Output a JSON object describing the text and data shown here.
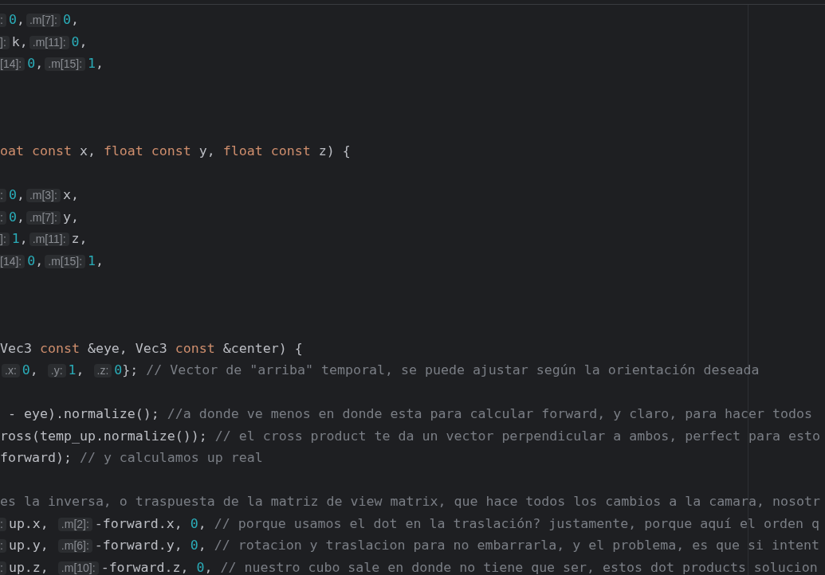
{
  "editor": {
    "lines": [
      {
        "kind": "code",
        "segments": [
          {
            "kind": "cuthint",
            "text": ":"
          },
          {
            "kind": "code",
            "tokens": [
              {
                "kind": "number",
                "text": "0"
              },
              {
                "kind": "plain",
                "text": ","
              }
            ]
          },
          {
            "kind": "hint",
            "text": ".m[7]:"
          },
          {
            "kind": "code",
            "tokens": [
              {
                "kind": "number",
                "text": "0"
              },
              {
                "kind": "plain",
                "text": ","
              }
            ]
          }
        ]
      },
      {
        "kind": "code",
        "segments": [
          {
            "kind": "cuthint",
            "text": "]:"
          },
          {
            "kind": "code",
            "tokens": [
              {
                "kind": "plain",
                "text": "k,"
              }
            ]
          },
          {
            "kind": "hint",
            "text": ".m[11]:"
          },
          {
            "kind": "code",
            "tokens": [
              {
                "kind": "number",
                "text": "0"
              },
              {
                "kind": "plain",
                "text": ","
              }
            ]
          }
        ]
      },
      {
        "kind": "code",
        "segments": [
          {
            "kind": "cuthint",
            "text": "[14]:"
          },
          {
            "kind": "code",
            "tokens": [
              {
                "kind": "number",
                "text": "0"
              },
              {
                "kind": "plain",
                "text": ","
              }
            ]
          },
          {
            "kind": "hint",
            "text": ".m[15]:"
          },
          {
            "kind": "code",
            "tokens": [
              {
                "kind": "number",
                "text": "1"
              },
              {
                "kind": "plain",
                "text": ","
              }
            ]
          }
        ]
      },
      {
        "kind": "blank"
      },
      {
        "kind": "blank"
      },
      {
        "kind": "blank"
      },
      {
        "kind": "code",
        "segments": [
          {
            "kind": "code",
            "tokens": [
              {
                "kind": "keyword",
                "text": "oat const"
              },
              {
                "kind": "plain",
                "text": " x, "
              },
              {
                "kind": "keyword",
                "text": "float const"
              },
              {
                "kind": "plain",
                "text": " y, "
              },
              {
                "kind": "keyword",
                "text": "float const"
              },
              {
                "kind": "plain",
                "text": " z) {"
              }
            ]
          }
        ]
      },
      {
        "kind": "blank"
      },
      {
        "kind": "code",
        "segments": [
          {
            "kind": "cuthint",
            "text": ":"
          },
          {
            "kind": "code",
            "tokens": [
              {
                "kind": "number",
                "text": "0"
              },
              {
                "kind": "plain",
                "text": ","
              }
            ]
          },
          {
            "kind": "hint",
            "text": ".m[3]:"
          },
          {
            "kind": "code",
            "tokens": [
              {
                "kind": "plain",
                "text": "x,"
              }
            ]
          }
        ]
      },
      {
        "kind": "code",
        "segments": [
          {
            "kind": "cuthint",
            "text": ":"
          },
          {
            "kind": "code",
            "tokens": [
              {
                "kind": "number",
                "text": "0"
              },
              {
                "kind": "plain",
                "text": ","
              }
            ]
          },
          {
            "kind": "hint",
            "text": ".m[7]:"
          },
          {
            "kind": "code",
            "tokens": [
              {
                "kind": "plain",
                "text": "y,"
              }
            ]
          }
        ]
      },
      {
        "kind": "code",
        "segments": [
          {
            "kind": "cuthint",
            "text": "]:"
          },
          {
            "kind": "code",
            "tokens": [
              {
                "kind": "number",
                "text": "1"
              },
              {
                "kind": "plain",
                "text": ","
              }
            ]
          },
          {
            "kind": "hint",
            "text": ".m[11]:"
          },
          {
            "kind": "code",
            "tokens": [
              {
                "kind": "plain",
                "text": "z,"
              }
            ]
          }
        ]
      },
      {
        "kind": "code",
        "segments": [
          {
            "kind": "cuthint",
            "text": "[14]:"
          },
          {
            "kind": "code",
            "tokens": [
              {
                "kind": "number",
                "text": "0"
              },
              {
                "kind": "plain",
                "text": ","
              }
            ]
          },
          {
            "kind": "hint",
            "text": ".m[15]:"
          },
          {
            "kind": "code",
            "tokens": [
              {
                "kind": "number",
                "text": "1"
              },
              {
                "kind": "plain",
                "text": ","
              }
            ]
          }
        ]
      },
      {
        "kind": "blank"
      },
      {
        "kind": "blank"
      },
      {
        "kind": "blank"
      },
      {
        "kind": "code",
        "segments": [
          {
            "kind": "code",
            "tokens": [
              {
                "kind": "plain",
                "text": "Vec3 "
              },
              {
                "kind": "keyword",
                "text": "const"
              },
              {
                "kind": "plain",
                "text": " &eye, Vec3 "
              },
              {
                "kind": "keyword",
                "text": "const"
              },
              {
                "kind": "plain",
                "text": " &center) {"
              }
            ]
          }
        ]
      },
      {
        "kind": "code",
        "segments": [
          {
            "kind": "hint",
            "text": ".x:"
          },
          {
            "kind": "code",
            "tokens": [
              {
                "kind": "number",
                "text": "0"
              },
              {
                "kind": "plain",
                "text": ", "
              }
            ]
          },
          {
            "kind": "hint",
            "text": ".y:"
          },
          {
            "kind": "code",
            "tokens": [
              {
                "kind": "number",
                "text": "1"
              },
              {
                "kind": "plain",
                "text": ", "
              }
            ]
          },
          {
            "kind": "hint",
            "text": ".z:"
          },
          {
            "kind": "code",
            "tokens": [
              {
                "kind": "number",
                "text": "0"
              },
              {
                "kind": "plain",
                "text": "};"
              }
            ]
          },
          {
            "kind": "comment",
            "text": "// Vector de \"arriba\" temporal, se puede ajustar según la orientación deseada"
          }
        ]
      },
      {
        "kind": "blank"
      },
      {
        "kind": "code",
        "segments": [
          {
            "kind": "code",
            "tokens": [
              {
                "kind": "plain",
                "text": " - eye).normalize();"
              }
            ]
          },
          {
            "kind": "comment",
            "text": "//a donde ve menos en donde esta para calcular forward, y claro, para hacer todos"
          }
        ]
      },
      {
        "kind": "code",
        "segments": [
          {
            "kind": "code",
            "tokens": [
              {
                "kind": "plain",
                "text": "ross(temp_up.normalize());"
              }
            ]
          },
          {
            "kind": "comment",
            "text": "// el cross product te da un vector perpendicular a ambos, perfect para esto"
          }
        ]
      },
      {
        "kind": "code",
        "segments": [
          {
            "kind": "code",
            "tokens": [
              {
                "kind": "plain",
                "text": "forward);"
              }
            ]
          },
          {
            "kind": "comment",
            "text": "// y calculamos up real"
          }
        ]
      },
      {
        "kind": "blank"
      },
      {
        "kind": "code",
        "segments": [
          {
            "kind": "comment",
            "text": "es la inversa, o traspuesta de la matriz de view matrix, que hace todos los cambios a la camara, nosotr"
          }
        ]
      },
      {
        "kind": "code",
        "segments": [
          {
            "kind": "cuthint",
            "text": ":"
          },
          {
            "kind": "code",
            "tokens": [
              {
                "kind": "plain",
                "text": "up.x, "
              }
            ]
          },
          {
            "kind": "hint",
            "text": ".m[2]:"
          },
          {
            "kind": "code",
            "tokens": [
              {
                "kind": "plain",
                "text": "-forward.x, "
              },
              {
                "kind": "number",
                "text": "0"
              },
              {
                "kind": "plain",
                "text": ","
              }
            ]
          },
          {
            "kind": "comment",
            "text": "// porque usamos el dot en la traslación? justamente, porque aquí el orden q"
          }
        ]
      },
      {
        "kind": "code",
        "segments": [
          {
            "kind": "cuthint",
            "text": ":"
          },
          {
            "kind": "code",
            "tokens": [
              {
                "kind": "plain",
                "text": "up.y, "
              }
            ]
          },
          {
            "kind": "hint",
            "text": ".m[6]:"
          },
          {
            "kind": "code",
            "tokens": [
              {
                "kind": "plain",
                "text": "-forward.y, "
              },
              {
                "kind": "number",
                "text": "0"
              },
              {
                "kind": "plain",
                "text": ","
              }
            ]
          },
          {
            "kind": "comment",
            "text": "// rotacion y traslacion para no embarrarla, y el problema, es que si intent"
          }
        ]
      },
      {
        "kind": "code",
        "segments": [
          {
            "kind": "cuthint",
            "text": ":"
          },
          {
            "kind": "code",
            "tokens": [
              {
                "kind": "plain",
                "text": "up.z, "
              }
            ]
          },
          {
            "kind": "hint",
            "text": ".m[10]:"
          },
          {
            "kind": "code",
            "tokens": [
              {
                "kind": "plain",
                "text": "-forward.z, "
              },
              {
                "kind": "number",
                "text": "0"
              },
              {
                "kind": "plain",
                "text": ","
              }
            ]
          },
          {
            "kind": "comment",
            "text": "// nuestro cubo sale en donde no tiene que ser, estos dot products solucion"
          }
        ]
      }
    ]
  }
}
